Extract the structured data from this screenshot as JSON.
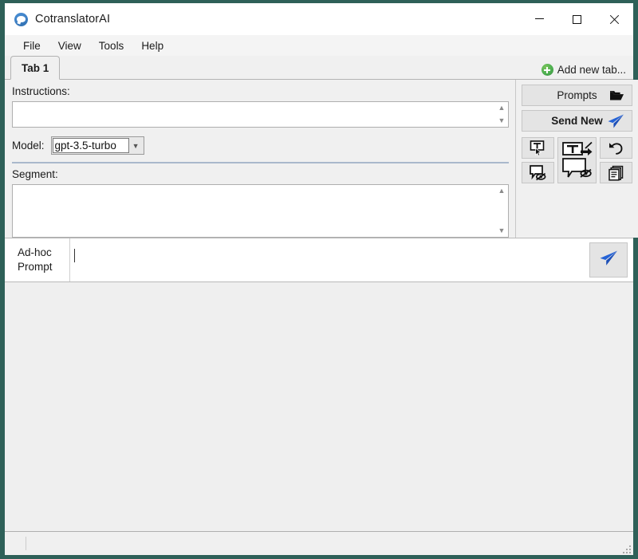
{
  "window": {
    "title": "CotranslatorAI",
    "app_icon": "chat-bubble-icon",
    "controls": {
      "minimize": "minimize-icon",
      "maximize": "maximize-icon",
      "close": "close-icon"
    }
  },
  "menubar": {
    "items": [
      {
        "label": "File"
      },
      {
        "label": "View"
      },
      {
        "label": "Tools"
      },
      {
        "label": "Help"
      }
    ]
  },
  "tabs": {
    "items": [
      {
        "label": "Tab 1",
        "active": true
      }
    ],
    "add_tab_label": "Add new tab...",
    "add_tab_icon": "plus-circle-icon"
  },
  "left_panel": {
    "instructions_label": "Instructions:",
    "instructions_value": "",
    "instructions_placeholder": "",
    "model_label": "Model:",
    "model_value": "gpt-3.5-turbo",
    "model_options": [
      "gpt-3.5-turbo"
    ],
    "segment_label": "Segment:",
    "segment_value": "",
    "segment_placeholder": ""
  },
  "right_panel": {
    "prompts_label": "Prompts",
    "prompts_icon": "folder-open-icon",
    "send_new_label": "Send New",
    "send_new_icon": "paper-plane-icon",
    "tools": [
      {
        "name": "insert-text-cursor-icon"
      },
      {
        "name": "hide-bubble-icon"
      },
      {
        "name": "send-text-to-bubble-icon"
      },
      {
        "name": "undo-icon"
      },
      {
        "name": "copy-icon"
      }
    ]
  },
  "adhoc": {
    "label_line1": "Ad-hoc",
    "label_line2": "Prompt",
    "input_value": "",
    "input_placeholder": "",
    "send_icon": "paper-plane-icon"
  },
  "output": {
    "content": ""
  },
  "statusbar": {
    "text": ""
  },
  "colors": {
    "desktop": "#2e6058",
    "window_bg": "#f0f0f0",
    "accent_blue": "#2563d6",
    "accent_green": "#4caf50",
    "separator": "#a9b8cc"
  }
}
